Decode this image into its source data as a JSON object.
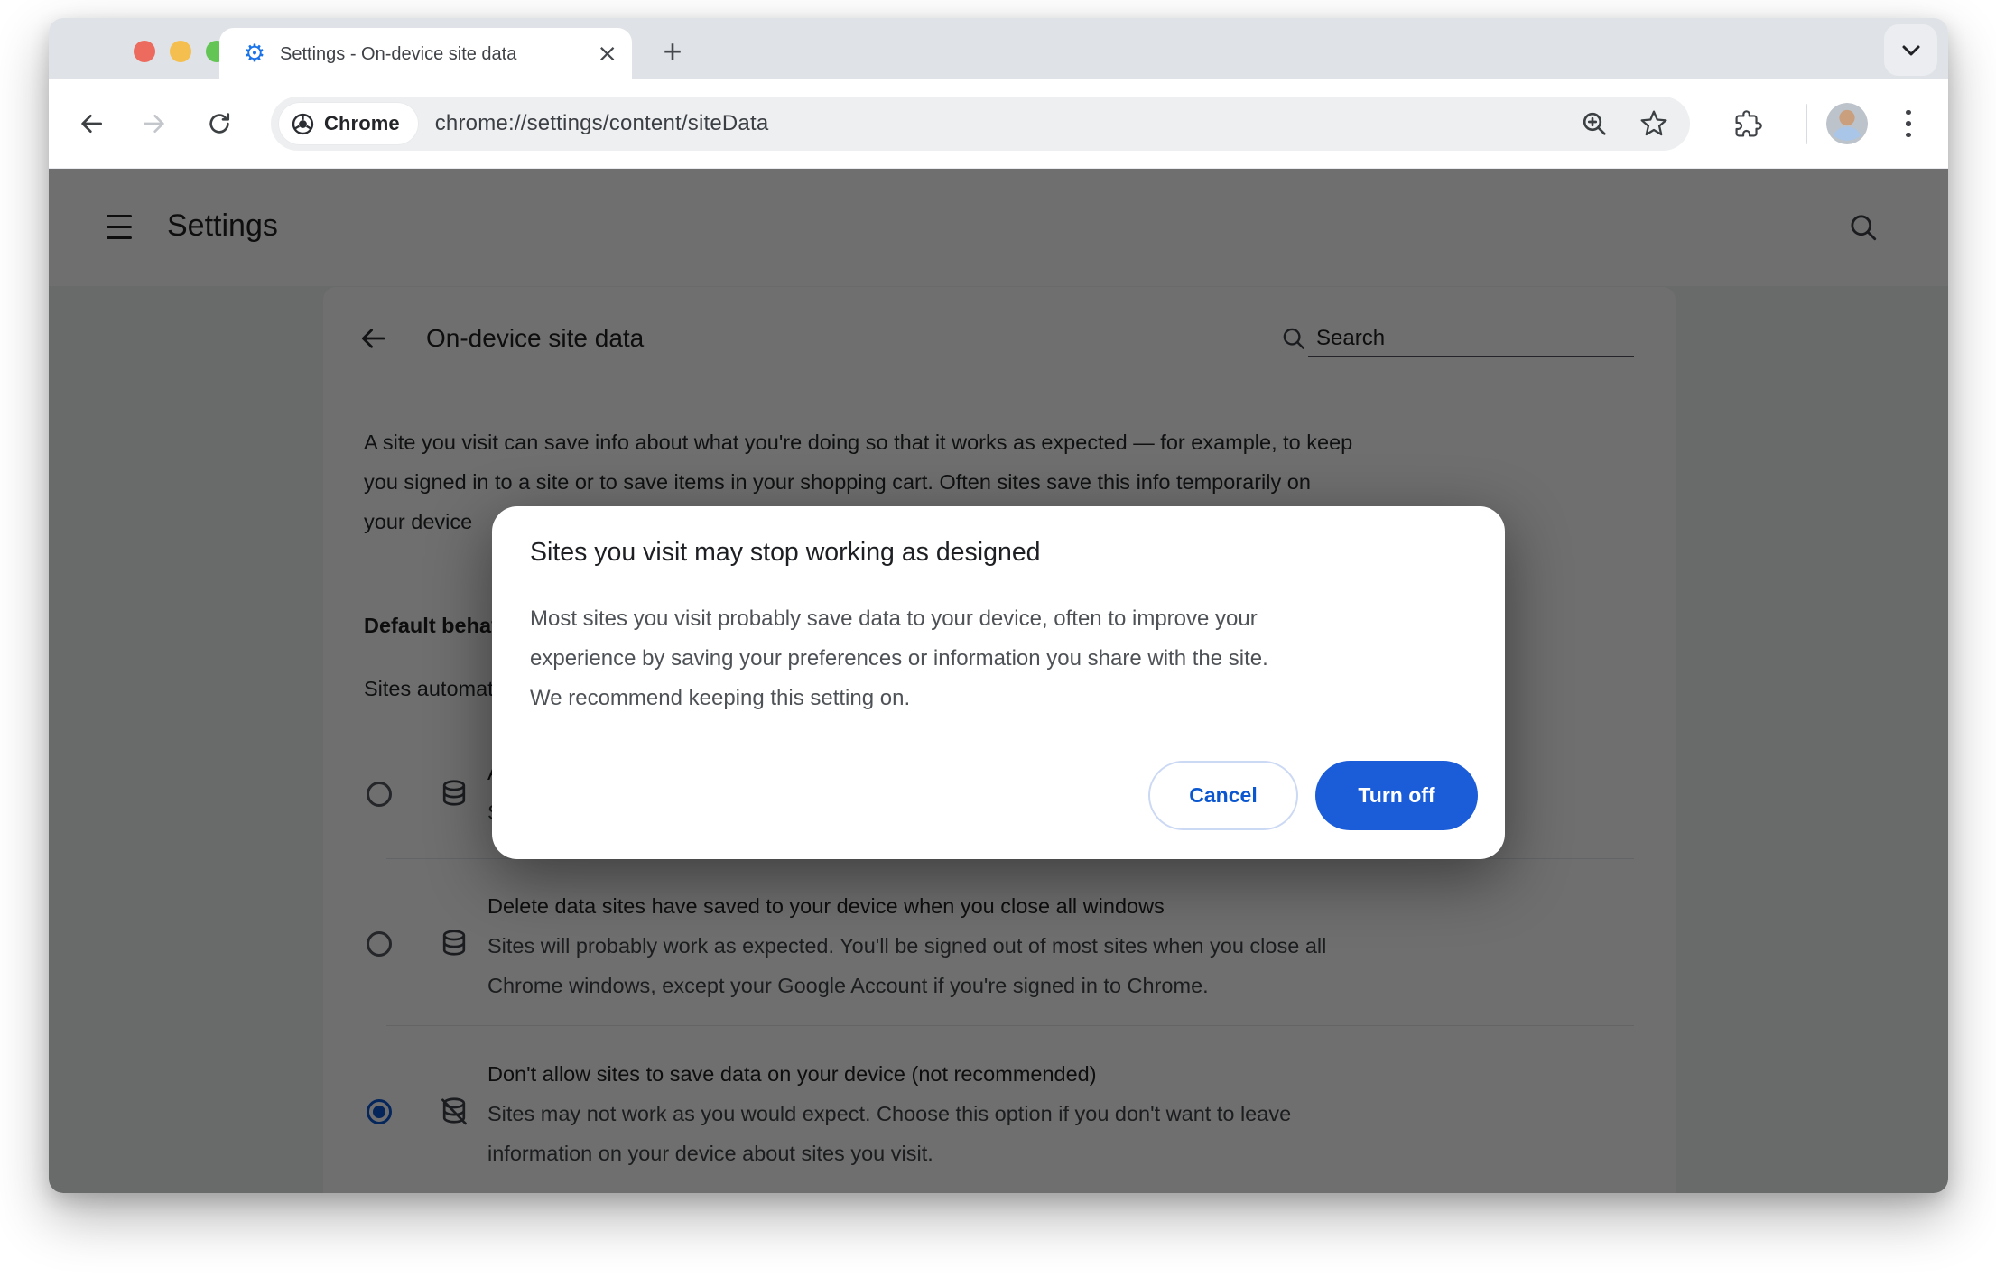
{
  "browser": {
    "tab_title": "Settings - On-device site data",
    "new_tab_label": "+",
    "chip_label": "Chrome",
    "url": "chrome://settings/content/siteData"
  },
  "settings_header": {
    "title": "Settings"
  },
  "page": {
    "title": "On-device site data",
    "search_placeholder": "Search",
    "intro_lines": [
      "A site you visit can save info about what you're doing so that it works as expected — for example, to keep",
      "you signed in to a site or to save items in your shopping cart. Often sites save this info temporarily on",
      "your device"
    ],
    "default_behavior_label": "Default behavior",
    "default_behavior_caption": "Sites automatically follow this setting when you visit them",
    "options": [
      {
        "title": "Allow sites to save data on your device",
        "desc_lines": [
          "Sites will work as designed"
        ],
        "selected": false
      },
      {
        "title": "Delete data sites have saved to your device when you close all windows",
        "desc_lines": [
          "Sites will probably work as expected. You'll be signed out of most sites when you close all",
          "Chrome windows, except your Google Account if you're signed in to Chrome."
        ],
        "selected": false
      },
      {
        "title": "Don't allow sites to save data on your device (not recommended)",
        "desc_lines": [
          "Sites may not work as you would expect. Choose this option if you don't want to leave",
          "information on your device about sites you visit."
        ],
        "selected": true
      }
    ]
  },
  "dialog": {
    "title": "Sites you visit may stop working as designed",
    "body_lines": [
      "Most sites you visit probably save data to your device, often to improve your",
      "experience by saving your preferences or information you share with the site.",
      "We recommend keeping this setting on."
    ],
    "cancel_label": "Cancel",
    "confirm_label": "Turn off"
  },
  "colors": {
    "accent_blue": "#0b57d0",
    "confirm_button_bg": "#1b5cd8",
    "favicon_blue": "#1a73e8"
  }
}
